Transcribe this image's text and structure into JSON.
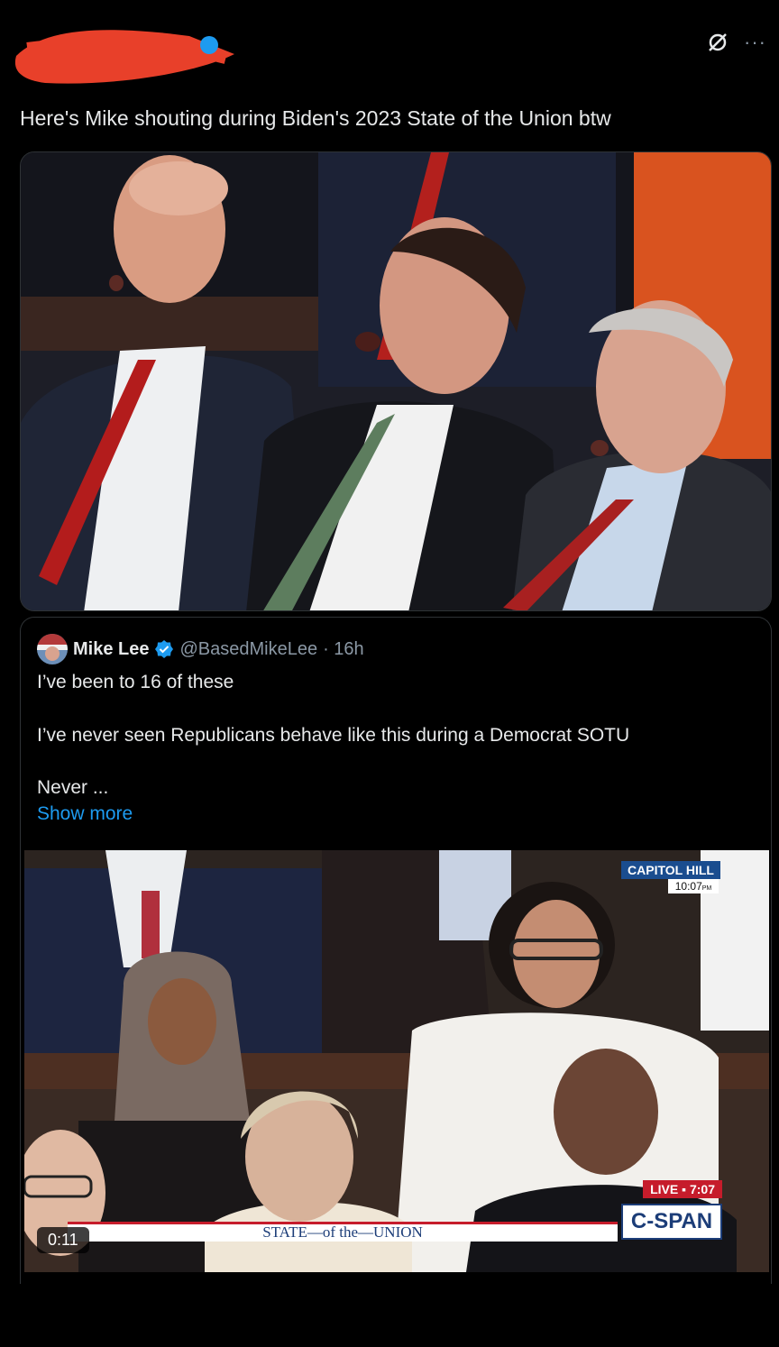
{
  "post": {
    "text": "Here's Mike shouting during Biden's 2023 State of the Union btw"
  },
  "header": {
    "grok_icon": "grok-slash-icon",
    "more_icon": "more-horizontal-icon",
    "more_label": "···"
  },
  "quote": {
    "name": "Mike Lee",
    "handle": "@BasedMikeLee",
    "time": "· 16h",
    "line1": "I’ve been to 16 of these",
    "line2": "I’ve never seen Republicans behave like this during a Democrat SOTU",
    "line3": "Never ...",
    "show_more": "Show more"
  },
  "video": {
    "location": "CAPITOL HILL",
    "clock": "10:07",
    "clock_suffix": "PM",
    "banner": "STATE—of the—UNION",
    "live_label": "LIVE",
    "live_time": "7:07",
    "network": "C-SPAN",
    "timer": "0:11"
  },
  "colors": {
    "background": "#000000",
    "link": "#1d9bf0",
    "verified": "#1d9bf0",
    "redaction": "#e8402a",
    "cspan_red": "#c61c2b",
    "cspan_blue": "#1c3d78"
  }
}
